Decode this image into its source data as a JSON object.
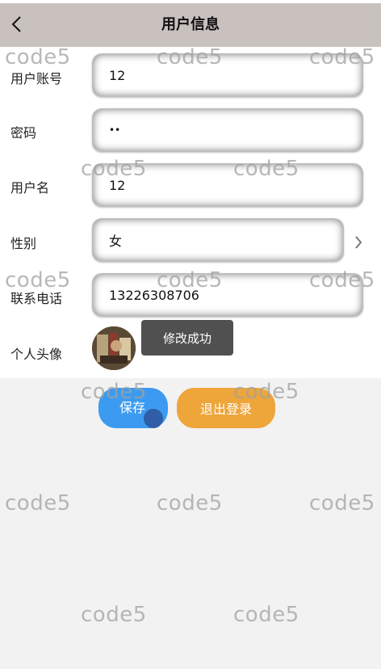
{
  "header": {
    "title": "用户信息"
  },
  "form": {
    "account": {
      "label": "用户账号",
      "value": "12"
    },
    "password": {
      "label": "密码",
      "value": "••"
    },
    "username": {
      "label": "用户名",
      "value": "12"
    },
    "gender": {
      "label": "性别",
      "value": "女"
    },
    "phone": {
      "label": "联系电话",
      "value": "13226308706"
    },
    "avatar": {
      "label": "个人头像"
    }
  },
  "toast": {
    "message": "修改成功"
  },
  "buttons": {
    "save_label": "保存",
    "logout_label": "退出登录"
  },
  "watermark": {
    "text": "code5"
  },
  "colors": {
    "header_bg": "#c9c1be",
    "save_button": "#3c9bf0",
    "logout_button": "#eea53a",
    "toast_bg": "#505050"
  }
}
